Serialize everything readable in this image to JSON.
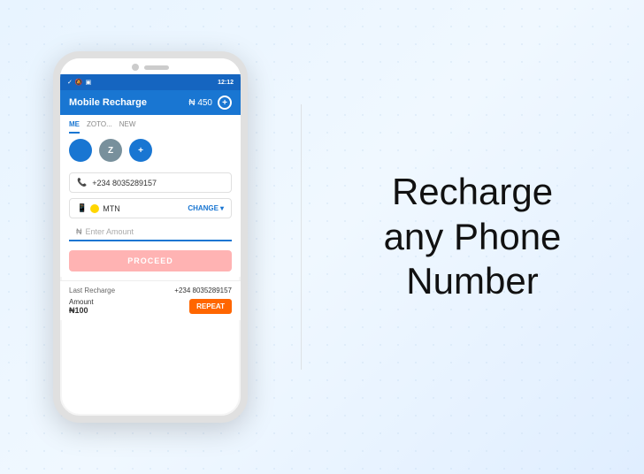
{
  "page": {
    "background": "#e8f4ff"
  },
  "phone": {
    "status_bar": {
      "time": "12:12",
      "icons": [
        "wifi",
        "signal",
        "battery"
      ]
    },
    "header": {
      "title": "Mobile Recharge",
      "amount": "₦ 450",
      "add_label": "+"
    },
    "tabs": [
      {
        "label": "ME",
        "active": true
      },
      {
        "label": "ZOTO...",
        "active": false
      },
      {
        "label": "NEW",
        "active": false
      }
    ],
    "contacts": [
      {
        "initial": "👤",
        "type": "me"
      },
      {
        "initial": "Z",
        "type": "zoto"
      },
      {
        "initial": "+",
        "type": "add"
      }
    ],
    "form": {
      "phone_icon": "📞",
      "phone_number": "+234 8035289157",
      "network_icon": "📱",
      "network_name": "MTN",
      "change_label": "CHANGE",
      "amount_icon": "₦",
      "amount_placeholder": "Enter Amount",
      "proceed_label": "PROCEED"
    },
    "last_recharge": {
      "label": "Last Recharge",
      "number": "+234 8035289157",
      "amount_label": "Amount",
      "amount_value": "₦100",
      "repeat_label": "REPEAT"
    }
  },
  "tagline": {
    "line1": "Recharge",
    "line2": "any Phone",
    "line3": "Number"
  }
}
